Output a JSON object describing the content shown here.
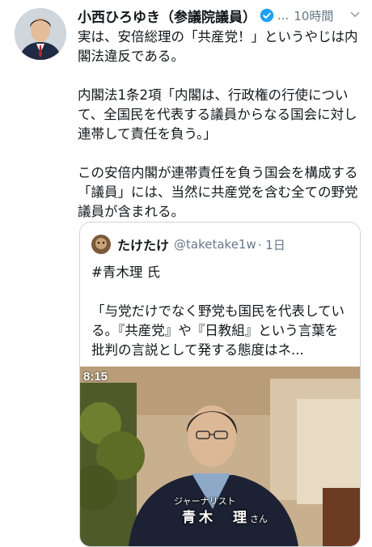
{
  "tweet": {
    "author_name": "小西ひろゆき（参議院議員）",
    "handle": "...",
    "time": "10時間",
    "paragraphs": [
      "実は、安倍総理の「共産党！」というやじは内閣法違反である。",
      "内閣法1条2項「内閣は、行政権の行使について、全国民を代表する議員からなる国会に対し連帯して責任を負う。」",
      "この安倍内閣が連帯責任を負う国会を構成する「議員」には、当然に共産党を含む全ての野党議員が含まれる。"
    ]
  },
  "quoted": {
    "author_name": "たけたけ",
    "handle": "@taketake1w",
    "time": "· 1日",
    "paragraphs": [
      "#青木理 氏",
      "「与党だけでなく野党も国民を代表している。『共産党』や『日教組』という言葉を批判の言説として発する態度はネ..."
    ],
    "media": {
      "overlay_time": "8:15",
      "caption_role": "ジャーナリスト",
      "caption_name": "青木　理",
      "caption_suffix": "さん"
    }
  },
  "colors": {
    "verified_blue": "#1da1f2",
    "secondary_text": "#657786",
    "border": "#ccd6dd"
  },
  "icons": [
    "avatar-photo",
    "verified-badge-icon",
    "chevron-down-icon"
  ]
}
